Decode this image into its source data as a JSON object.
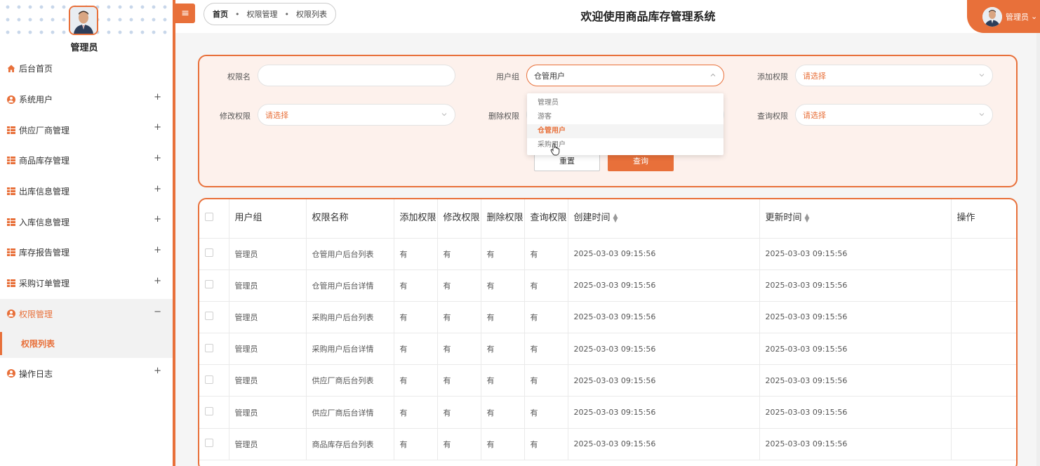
{
  "sidebar": {
    "admin_name": "管理员",
    "items": [
      {
        "label": "后台首页",
        "icon": "home-icon",
        "expand": ""
      },
      {
        "label": "系统用户",
        "icon": "user-icon",
        "expand": "+"
      },
      {
        "label": "供应厂商管理",
        "icon": "grid-icon",
        "expand": "+"
      },
      {
        "label": "商品库存管理",
        "icon": "grid-icon",
        "expand": "+"
      },
      {
        "label": "出库信息管理",
        "icon": "grid-icon",
        "expand": "+"
      },
      {
        "label": "入库信息管理",
        "icon": "grid-icon",
        "expand": "+"
      },
      {
        "label": "库存报告管理",
        "icon": "grid-icon",
        "expand": "+"
      },
      {
        "label": "采购订单管理",
        "icon": "grid-icon",
        "expand": "+"
      },
      {
        "label": "权限管理",
        "icon": "user-icon",
        "expand": "−"
      },
      {
        "label": "操作日志",
        "icon": "user-icon",
        "expand": "+"
      }
    ],
    "submenu_label": "权限列表"
  },
  "header": {
    "toggle": "≡",
    "breadcrumb": [
      "首页",
      "权限管理",
      "权限列表"
    ],
    "title": "欢迎使用商品库存管理系统",
    "user": "管理员",
    "user_caret": "⌄"
  },
  "search": {
    "perm_name_label": "权限名",
    "perm_name_value": "",
    "user_group_label": "用户组",
    "user_group_value": "仓管用户",
    "add_perm_label": "添加权限",
    "add_perm_placeholder": "请选择",
    "edit_perm_label": "修改权限",
    "edit_perm_placeholder": "请选择",
    "delete_perm_label": "删除权限",
    "query_perm_label": "查询权限",
    "query_perm_placeholder": "请选择",
    "reset_label": "重置",
    "query_label": "查询",
    "dropdown_options": [
      "管理员",
      "游客",
      "仓管用户",
      "采购用户"
    ]
  },
  "table": {
    "headers": [
      "用户组",
      "权限名称",
      "添加权限",
      "修改权限",
      "删除权限",
      "查询权限",
      "创建时间",
      "更新时间",
      "操作"
    ],
    "rows": [
      [
        "管理员",
        "仓管用户后台列表",
        "有",
        "有",
        "有",
        "有",
        "2025-03-03 09:15:56",
        "2025-03-03 09:15:56",
        ""
      ],
      [
        "管理员",
        "仓管用户后台详情",
        "有",
        "有",
        "有",
        "有",
        "2025-03-03 09:15:56",
        "2025-03-03 09:15:56",
        ""
      ],
      [
        "管理员",
        "采购用户后台列表",
        "有",
        "有",
        "有",
        "有",
        "2025-03-03 09:15:56",
        "2025-03-03 09:15:56",
        ""
      ],
      [
        "管理员",
        "采购用户后台详情",
        "有",
        "有",
        "有",
        "有",
        "2025-03-03 09:15:56",
        "2025-03-03 09:15:56",
        ""
      ],
      [
        "管理员",
        "供应厂商后台列表",
        "有",
        "有",
        "有",
        "有",
        "2025-03-03 09:15:56",
        "2025-03-03 09:15:56",
        ""
      ],
      [
        "管理员",
        "供应厂商后台详情",
        "有",
        "有",
        "有",
        "有",
        "2025-03-03 09:15:56",
        "2025-03-03 09:15:56",
        ""
      ],
      [
        "管理员",
        "商品库存后台列表",
        "有",
        "有",
        "有",
        "有",
        "2025-03-03 09:15:56",
        "2025-03-03 09:15:56",
        ""
      ]
    ]
  },
  "colors": {
    "accent": "#e8703a",
    "card_bg": "#fdf1ec"
  }
}
